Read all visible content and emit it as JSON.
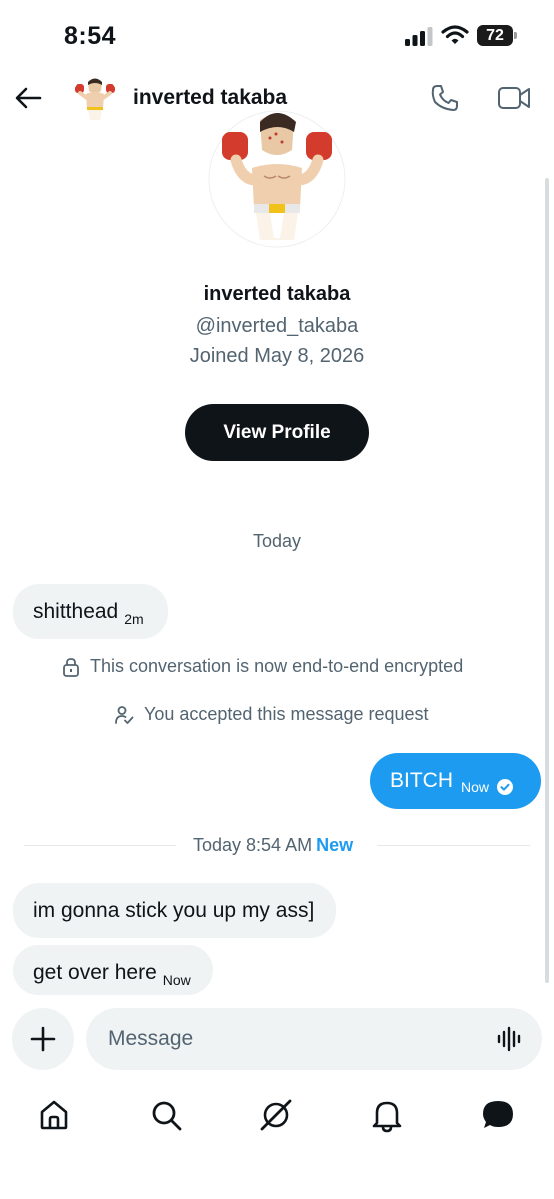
{
  "status_bar": {
    "time": "8:54",
    "battery": "72"
  },
  "header": {
    "title": "inverted takaba"
  },
  "profile": {
    "name": "inverted takaba",
    "handle": "@inverted_takaba",
    "joined": "Joined May 8, 2026",
    "view_button": "View Profile"
  },
  "chat": {
    "day_label": "Today",
    "messages": [
      {
        "text": "shitthead",
        "time": "2m"
      },
      {
        "text": "BITCH",
        "time": "Now"
      },
      {
        "text": "im gonna stick you up my ass]"
      },
      {
        "text": "get over here",
        "time": "Now"
      }
    ],
    "system": [
      "This conversation is now end-to-end encrypted",
      "You accepted this message request"
    ],
    "new_divider": {
      "time": "Today 8:54 AM",
      "label": "New"
    }
  },
  "composer": {
    "placeholder": "Message"
  },
  "colors": {
    "accent": "#1d9bf0",
    "bubble_in": "#eff3f4",
    "text_secondary": "#536471"
  },
  "icons": [
    "back-arrow-icon",
    "phone-icon",
    "video-icon",
    "lock-icon",
    "person-check-icon",
    "check-icon",
    "plus-icon",
    "voice-icon",
    "home-icon",
    "search-icon",
    "grok-icon",
    "bell-icon",
    "messages-icon"
  ]
}
